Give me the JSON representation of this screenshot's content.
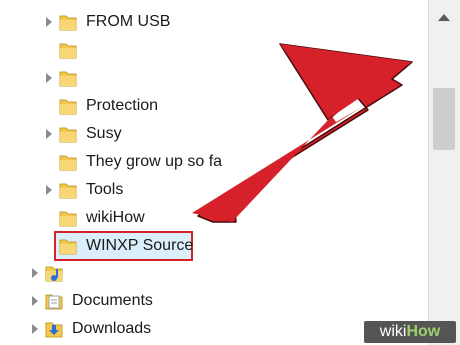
{
  "tree": {
    "items": [
      {
        "label": "FROM USB",
        "expandable": true,
        "icon": "folder-icon"
      },
      {
        "label": "",
        "expandable": false,
        "icon": "folder-icon"
      },
      {
        "label": "",
        "expandable": true,
        "icon": "folder-icon"
      },
      {
        "label": "Protection",
        "expandable": false,
        "icon": "folder-icon"
      },
      {
        "label": "Susy",
        "expandable": true,
        "icon": "folder-icon"
      },
      {
        "label": "They grow up so fa",
        "expandable": false,
        "icon": "folder-icon"
      },
      {
        "label": "Tools",
        "expandable": true,
        "icon": "folder-icon"
      },
      {
        "label": "wikiHow",
        "expandable": false,
        "icon": "folder-icon"
      },
      {
        "label": "WINXP Source",
        "expandable": false,
        "icon": "folder-icon",
        "selected": true
      },
      {
        "label": "",
        "expandable": true,
        "icon": "music-folder-icon"
      },
      {
        "label": "Documents",
        "expandable": true,
        "icon": "documents-icon"
      },
      {
        "label": "Downloads",
        "expandable": true,
        "icon": "downloads-icon"
      }
    ]
  },
  "annotation": {
    "arrow_color": "#d6202a",
    "highlight_color": "#d6202a"
  },
  "watermark": {
    "prefix": "wiki",
    "suffix": "How"
  }
}
